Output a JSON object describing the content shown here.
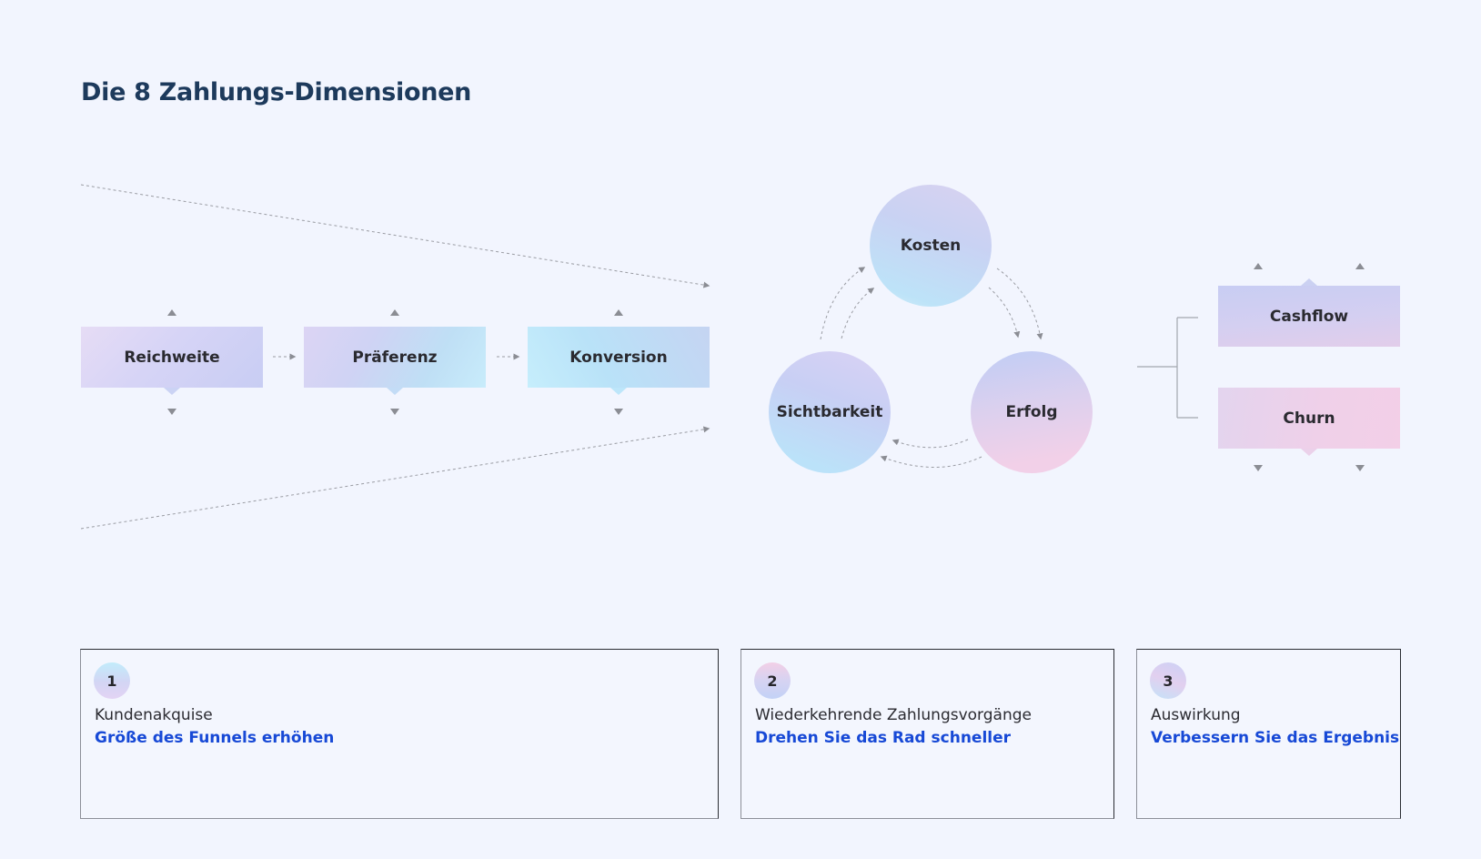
{
  "title": "Die 8 Zahlungs-Dimensionen",
  "colors": {
    "background": "#f2f5fe",
    "title": "#1d3a5c",
    "accent_link": "#1749d6",
    "connector": "#8b8d94"
  },
  "funnel": {
    "stages": [
      {
        "label": "Reichweite"
      },
      {
        "label": "Präferenz"
      },
      {
        "label": "Konversion"
      }
    ]
  },
  "cycle": {
    "nodes": [
      {
        "label": "Kosten"
      },
      {
        "label": "Sichtbarkeit"
      },
      {
        "label": "Erfolg"
      }
    ],
    "flow": [
      "Sichtbarkeit → Kosten",
      "Kosten → Erfolg",
      "Erfolg → Sichtbarkeit"
    ]
  },
  "impact": {
    "nodes": [
      {
        "label": "Cashflow"
      },
      {
        "label": "Churn"
      }
    ]
  },
  "cards": [
    {
      "number": "1",
      "title": "Kundenakquise",
      "subtitle": "Größe des Funnels erhöhen"
    },
    {
      "number": "2",
      "title": "Wiederkehrende Zahlungsvorgänge",
      "subtitle": "Drehen Sie das Rad schneller"
    },
    {
      "number": "3",
      "title": "Auswirkung",
      "subtitle": "Verbessern Sie das Ergebnis"
    }
  ]
}
